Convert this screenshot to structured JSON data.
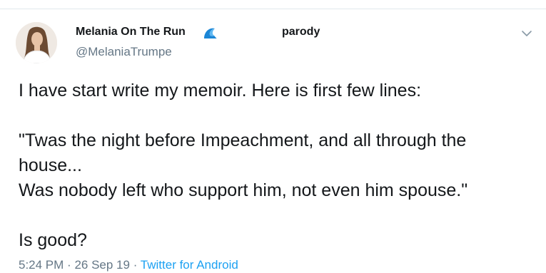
{
  "author": {
    "display_name": "Melania On The Run",
    "handle": "@MelaniaTrumpe",
    "bio_tag": "parody",
    "name_emoji_icon": "water-wave-icon",
    "avatar_icon": "profile-photo"
  },
  "tweet": {
    "text": "I have start write my memoir.  Here is first few lines:\n\n\"Twas the night before Impeachment, and all through the house...\nWas nobody left who support him, not even him spouse.\"\n\nIs good?",
    "time": "5:24 PM",
    "separator": "·",
    "date": "26 Sep 19",
    "source": "Twitter for Android"
  },
  "menu": {
    "icon": "chevron-down-icon"
  },
  "colors": {
    "text": "#14171a",
    "secondary": "#657786",
    "link": "#1da1f2",
    "divider": "#e1e8ed"
  }
}
